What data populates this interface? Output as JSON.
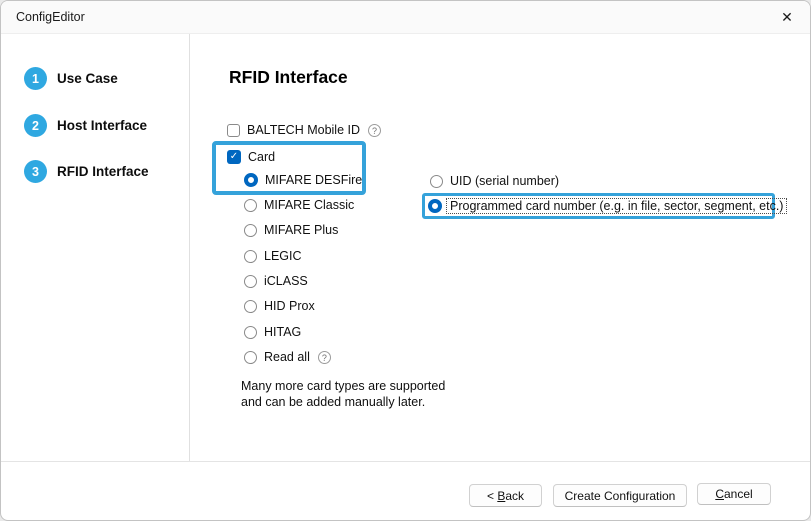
{
  "window": {
    "title": "ConfigEditor",
    "close_icon": "✕"
  },
  "colors": {
    "control_accent": "#0067C0",
    "annotation_highlight": "#35A2DA",
    "step_circle": "#2FA8E1"
  },
  "sidebar": {
    "steps": [
      {
        "number": "1",
        "label": "Use Case"
      },
      {
        "number": "2",
        "label": "Host Interface"
      },
      {
        "number": "3",
        "label": "RFID Interface"
      }
    ]
  },
  "main": {
    "title": "RFID Interface",
    "baltech_checkbox": {
      "label": "BALTECH Mobile ID",
      "checked": false,
      "help_icon": "?"
    },
    "card_checkbox": {
      "label": "Card",
      "checked": true,
      "check_icon": "✓"
    },
    "card_types": [
      {
        "label": "MIFARE DESFire",
        "selected": true
      },
      {
        "label": "MIFARE Classic",
        "selected": false
      },
      {
        "label": "MIFARE Plus",
        "selected": false
      },
      {
        "label": "LEGIC",
        "selected": false
      },
      {
        "label": "iCLASS",
        "selected": false
      },
      {
        "label": "HID Prox",
        "selected": false
      },
      {
        "label": "HITAG",
        "selected": false
      },
      {
        "label": "Read all",
        "selected": false,
        "help_icon": "?"
      }
    ],
    "number_sources": [
      {
        "label": "UID (serial number)",
        "selected": false
      },
      {
        "label": "Programmed card number (e.g. in file, sector, segment, etc.)",
        "selected": true
      }
    ],
    "note_line1": "Many more card types are supported",
    "note_line2": "and can be added manually later."
  },
  "footer": {
    "back_button": {
      "prefix": "< ",
      "accesskey": "B",
      "rest": "ack"
    },
    "create_button": {
      "label": "Create Configuration"
    },
    "cancel_button": {
      "accesskey": "C",
      "rest": "ancel"
    }
  }
}
